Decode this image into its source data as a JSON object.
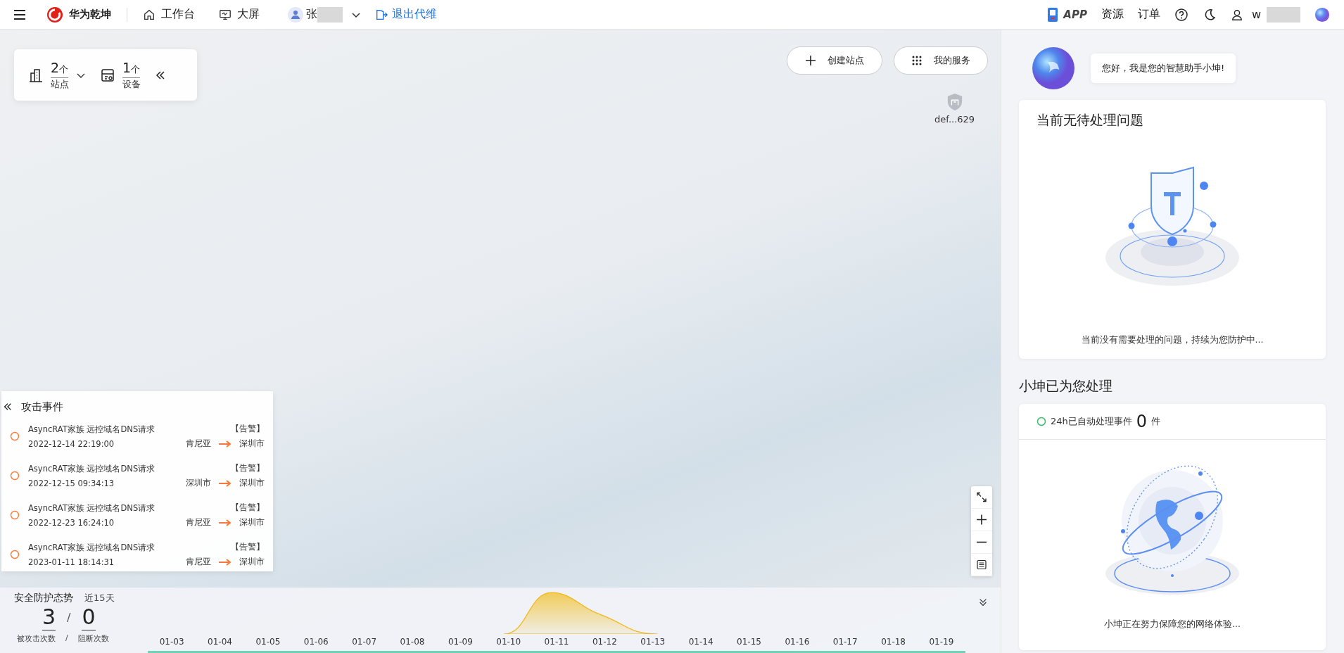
{
  "topbar": {
    "brand": "华为乾坤",
    "nav": [
      "工作台",
      "大屏"
    ],
    "user": "张",
    "exit": "退出代维",
    "app": "APP",
    "links": [
      "资源",
      "订单"
    ],
    "account": "w"
  },
  "stats": [
    {
      "value": "2",
      "unit": "个",
      "label": "站点"
    },
    {
      "value": "1",
      "unit": "个",
      "label": "设备"
    }
  ],
  "map_buttons": [
    "创建站点",
    "我的服务"
  ],
  "site_marker": "def...629",
  "attack_events": {
    "title": "攻击事件",
    "items": [
      {
        "name": "AsyncRAT家族 远控域名DNS请求",
        "time": "2022-12-14 22:19:00",
        "level": "【告警】",
        "from": "肯尼亚",
        "to": "深圳市"
      },
      {
        "name": "AsyncRAT家族 远控域名DNS请求",
        "time": "2022-12-15 09:34:13",
        "level": "【告警】",
        "from": "深圳市",
        "to": "深圳市"
      },
      {
        "name": "AsyncRAT家族 远控域名DNS请求",
        "time": "2022-12-23 16:24:10",
        "level": "【告警】",
        "from": "肯尼亚",
        "to": "深圳市"
      },
      {
        "name": "AsyncRAT家族 远控域名DNS请求",
        "time": "2023-01-11 18:14:31",
        "level": "【告警】",
        "from": "肯尼亚",
        "to": "深圳市"
      }
    ]
  },
  "posture": {
    "title": "安全防护态势",
    "range": "近15天",
    "attacked": "3",
    "value_separator": "/",
    "blocked": "0",
    "attacked_label": "被攻击次数",
    "label_separator": "/",
    "blocked_label": "阻断次数",
    "dates": [
      "01-03",
      "01-04",
      "01-05",
      "01-06",
      "01-07",
      "01-08",
      "01-09",
      "01-10",
      "01-11",
      "01-12",
      "01-13",
      "01-14",
      "01-15",
      "01-16",
      "01-17",
      "01-18",
      "01-19"
    ]
  },
  "assistant": {
    "greeting": "您好，我是您的智慧助手小坤!",
    "pending_title": "当前无待处理问题",
    "pending_caption": "当前没有需要处理的问题，持续为您防护中...",
    "handled_title": "小坤已为您处理",
    "handled_label": "24h已自动处理事件",
    "handled_count": "0",
    "handled_unit": "件",
    "handled_caption": "小坤正在努力保障您的网络体验..."
  }
}
